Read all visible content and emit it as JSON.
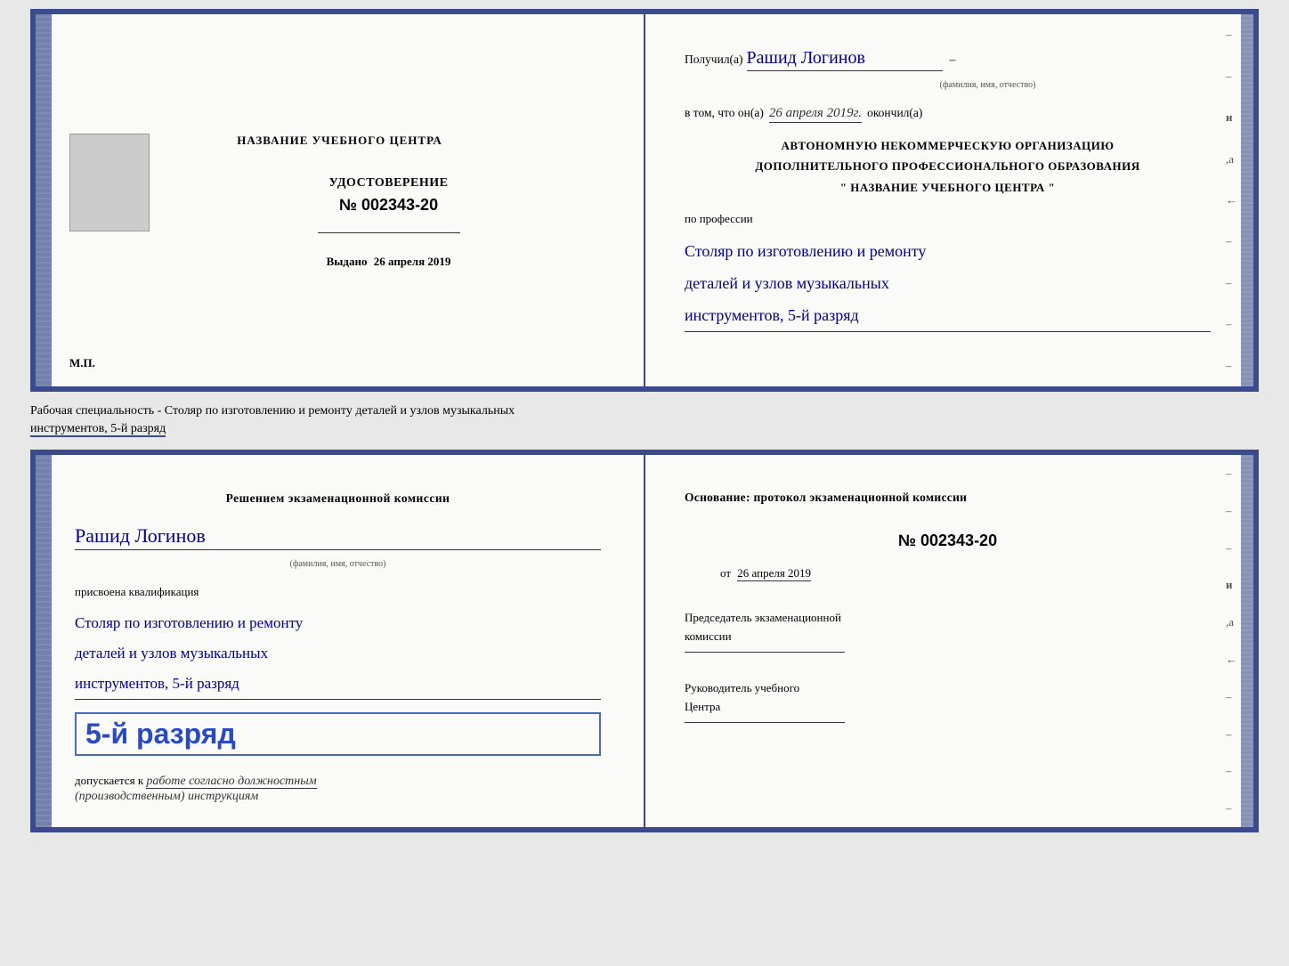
{
  "top_doc": {
    "left": {
      "title": "НАЗВАНИЕ УЧЕБНОГО ЦЕНТРА",
      "udostoverenie": "УДОСТОВЕРЕНИЕ",
      "number_prefix": "№",
      "number": "002343-20",
      "vydano_label": "Выдано",
      "vydano_date": "26 апреля 2019",
      "mp": "М.П."
    },
    "right": {
      "poluchil": "Получил(а)",
      "name": "Рашид Логинов",
      "fio_label": "(фамилия, имя, отчество)",
      "dash": "–",
      "vtom_text": "в том, что он(а)",
      "okончил": "окончил(а)",
      "vtom_date": "26 апреля 2019г.",
      "org_line1": "АВТОНОМНУЮ НЕКОММЕРЧЕСКУЮ ОРГАНИЗАЦИЮ",
      "org_line2": "ДОПОЛНИТЕЛЬНОГО ПРОФЕССИОНАЛЬНОГО ОБРАЗОВАНИЯ",
      "org_line3": "\"  НАЗВАНИЕ УЧЕБНОГО ЦЕНТРА  \"",
      "po_professii": "по профессии",
      "profession_line1": "Столяр по изготовлению и ремонту",
      "profession_line2": "деталей и узлов музыкальных",
      "profession_line3": "инструментов, 5-й разряд"
    }
  },
  "specialty_label": "Рабочая специальность - Столяр по изготовлению и ремонту деталей и узлов музыкальных",
  "specialty_label2": "инструментов, 5-й разряд",
  "bottom_doc": {
    "left": {
      "komissia_line1": "Решением  экзаменационной  комиссии",
      "name": "Рашид Логинов",
      "fio_label": "(фамилия, имя, отчество)",
      "prisvoena": "присвоена квалификация",
      "profession_line1": "Столяр по изготовлению и ремонту",
      "profession_line2": "деталей и узлов музыкальных",
      "profession_line3": "инструментов, 5-й разряд",
      "razryad_big": "5-й разряд",
      "dopuskaetsya": "допускается к",
      "rabota": "работе согласно должностным",
      "instruktsii": "(производственным) инструкциям"
    },
    "right": {
      "osnov": "Основание: протокол экзаменационной  комиссии",
      "number_prefix": "№",
      "number": "002343-20",
      "ot_prefix": "от",
      "ot_date": "26 апреля 2019",
      "predsedatel_line1": "Председатель экзаменационной",
      "predsedatel_line2": "комиссии",
      "rukovoditel_line1": "Руководитель учебного",
      "rukovoditel_line2": "Центра"
    }
  }
}
